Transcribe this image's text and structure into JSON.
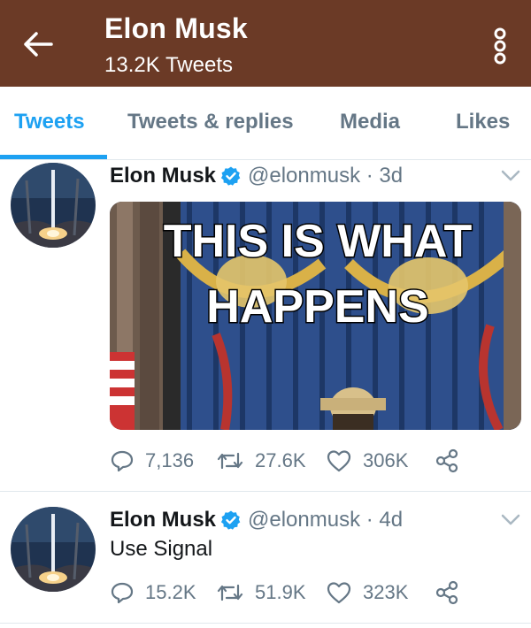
{
  "header": {
    "title": "Elon Musk",
    "subtitle": "13.2K Tweets",
    "back_icon": "arrow-left-icon",
    "more_icon": "more-vertical-icon",
    "background": "#6b3a26"
  },
  "tabs": [
    {
      "label": "Tweets",
      "active": true
    },
    {
      "label": "Tweets & replies",
      "active": false
    },
    {
      "label": "Media",
      "active": false
    },
    {
      "label": "Likes",
      "active": false
    }
  ],
  "accent": "#1da1f2",
  "tweets": [
    {
      "name": "Elon Musk",
      "handle_time": "@elonmusk · 3d",
      "text": "",
      "media": {
        "caption_line1": "THIS IS WHAT",
        "caption_line2": "HAPPENS"
      },
      "replies": "7,136",
      "retweets": "27.6K",
      "likes": "306K"
    },
    {
      "name": "Elon Musk",
      "handle_time": "@elonmusk · 4d",
      "text": "Use Signal",
      "replies": "15.2K",
      "retweets": "51.9K",
      "likes": "323K"
    }
  ]
}
